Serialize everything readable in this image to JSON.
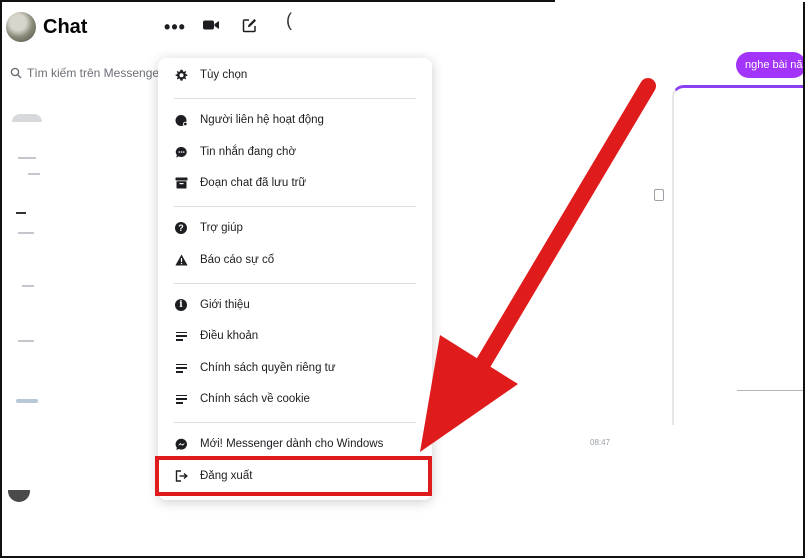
{
  "header": {
    "title": "Chat",
    "more_icon": "more-horizontal-icon",
    "video_icon": "video-camera-icon",
    "compose_icon": "compose-icon"
  },
  "search": {
    "placeholder": "Tìm kiếm trên Messenger",
    "icon": "search-icon"
  },
  "conversation": {
    "bubble_text": "nghe bài nă",
    "timestamp": "08:47"
  },
  "menu": {
    "items": [
      {
        "label": "Tùy chọn",
        "icon": "gear-icon"
      },
      {
        "label": "Người liên hệ hoạt động",
        "icon": "active-contacts-icon"
      },
      {
        "label": "Tin nhắn đang chờ",
        "icon": "chat-bubble-icon"
      },
      {
        "label": "Đoạn chat đã lưu trữ",
        "icon": "archive-icon"
      },
      {
        "label": "Trợ giúp",
        "icon": "help-icon"
      },
      {
        "label": "Báo cáo sự cố",
        "icon": "warning-icon"
      },
      {
        "label": "Giới thiệu",
        "icon": "info-icon"
      },
      {
        "label": "Điều khoản",
        "icon": "document-lines-icon"
      },
      {
        "label": "Chính sách quyền riêng tư",
        "icon": "document-lines-icon"
      },
      {
        "label": "Chính sách về cookie",
        "icon": "document-lines-icon"
      },
      {
        "label": "Mới! Messenger dành cho Windows",
        "icon": "messenger-icon"
      },
      {
        "label": "Đăng xuất",
        "icon": "logout-icon"
      }
    ]
  },
  "colors": {
    "accent_purple": "#a334fa",
    "annotation_red": "#e01b1b",
    "text": "#1c1e21",
    "muted": "#6b6f76"
  }
}
